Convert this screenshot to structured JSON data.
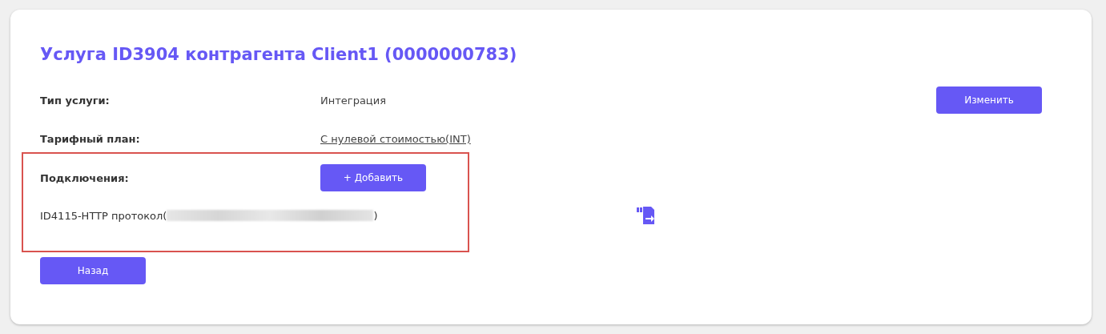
{
  "title": "Услуга ID3904 контрагента Client1 (0000000783)",
  "fields": [
    {
      "label": "Тип услуги:",
      "value": "Интеграция",
      "kind": "text"
    },
    {
      "label": "Тарифный план:",
      "value": "С нулевой стоимостью(INT)",
      "kind": "link"
    }
  ],
  "edit_button": "Изменить",
  "connections": {
    "label": "Подключения:",
    "add_button": "+ Добавить",
    "items": [
      {
        "text_before": "ID4115-HTTP протокол(",
        "text_after": ")"
      }
    ]
  },
  "back_button": "Назад"
}
